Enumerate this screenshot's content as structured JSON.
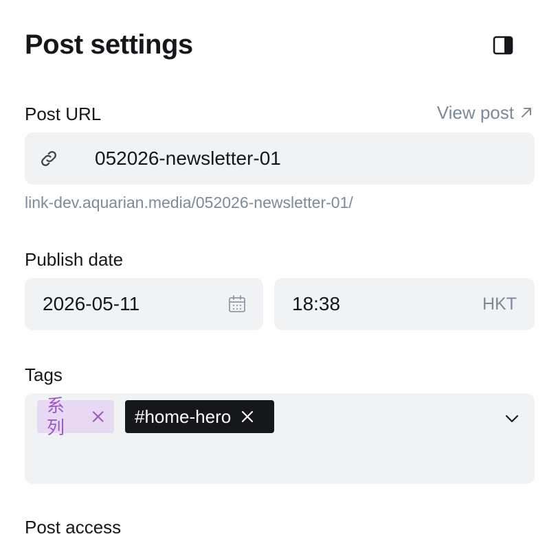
{
  "header": {
    "title": "Post settings",
    "sidebar_toggle_icon": "sidebar-panel-icon"
  },
  "post_url": {
    "label": "Post URL",
    "view_post_label": "View post",
    "value": "052026-newsletter-01",
    "hint": "link-dev.aquarian.media/052026-newsletter-01/",
    "link_icon": "link-icon",
    "external_icon": "arrow-up-right-icon"
  },
  "publish_date": {
    "label": "Publish date",
    "date": "2026-05-11",
    "time": "18:38",
    "timezone": "HKT",
    "calendar_icon": "calendar-icon"
  },
  "tags": {
    "label": "Tags",
    "items": [
      {
        "label": "系列",
        "color": "#9b59c4",
        "background": "#e8d9f2"
      },
      {
        "label": "#home-hero",
        "color": "#ffffff",
        "background": "#15171a"
      }
    ],
    "dropdown_icon": "chevron-down-icon"
  },
  "post_access": {
    "label": "Post access"
  },
  "colors": {
    "text": "#15171a",
    "muted": "#7c8b9a",
    "field_bg": "#f1f2f4"
  }
}
